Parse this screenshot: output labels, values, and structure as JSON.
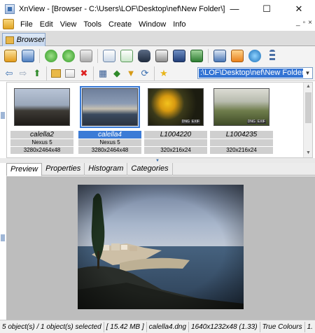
{
  "window": {
    "title": "XnView - [Browser - C:\\Users\\LOF\\Desktop\\nef\\New Folder\\]",
    "minimize": "—",
    "maximize": "☐",
    "close": "✕"
  },
  "menu": {
    "items": [
      "File",
      "Edit",
      "View",
      "Tools",
      "Create",
      "Window",
      "Info"
    ],
    "mdi_minimize": "_",
    "mdi_restore": "▫",
    "mdi_close": "×"
  },
  "doc_tab": {
    "label": "Browser"
  },
  "address": {
    "path": ":\\LOF\\Desktop\\nef\\New Folder\\"
  },
  "thumbnails": [
    {
      "name": "calella2",
      "camera": "Nexus 5",
      "dims": "3280x2464x48",
      "badges": [],
      "selected": false
    },
    {
      "name": "calella4",
      "camera": "Nexus 5",
      "dims": "3280x2464x48",
      "badges": [],
      "selected": true
    },
    {
      "name": "L1004220",
      "camera": "",
      "dims": "320x216x24",
      "badges": [
        "DNG",
        "EXIF"
      ],
      "selected": false
    },
    {
      "name": "L1004235",
      "camera": "",
      "dims": "320x216x24",
      "badges": [
        "DNG",
        "EXIF"
      ],
      "selected": false
    }
  ],
  "preview_tabs": [
    "Preview",
    "Properties",
    "Histogram",
    "Categories"
  ],
  "status": {
    "selection": "5 object(s) / 1 object(s) selected",
    "size": "[ 15.42 MB ]",
    "file": "calella4.dng",
    "resolution": "1640x1232x48 (1.33)",
    "colours": "True Colours",
    "extra": "1."
  },
  "icons": {
    "toolbar1": [
      "browser-icon",
      "fullscreen-icon",
      "rotate-left-icon",
      "rotate-right-icon",
      "batch-icon",
      "copy-icon",
      "move-icon",
      "find-icon",
      "print-icon",
      "scan-icon",
      "slideshow-icon",
      "capture-icon",
      "comment-icon",
      "web-icon",
      "more-icon"
    ],
    "toolbar2": [
      "back-icon",
      "forward-icon",
      "up-icon",
      "new-folder-icon",
      "edit-icon",
      "delete-icon",
      "view-mode-icon",
      "sort-icon",
      "filter-icon",
      "refresh-icon",
      "favorites-icon"
    ]
  }
}
